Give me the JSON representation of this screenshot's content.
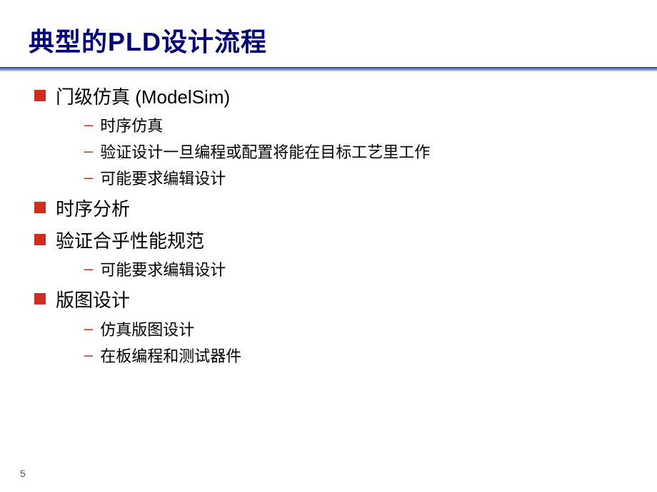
{
  "title": "典型的PLD设计流程",
  "bullets": [
    {
      "text": "门级仿真 (ModelSim)",
      "sub": [
        "时序仿真",
        "验证设计一旦编程或配置将能在目标工艺里工作",
        "可能要求编辑设计"
      ]
    },
    {
      "text": "时序分析",
      "sub": []
    },
    {
      "text": "验证合乎性能规范",
      "sub": [
        "可能要求编辑设计"
      ]
    },
    {
      "text": "版图设计",
      "sub": [
        "仿真版图设计",
        "在板编程和测试器件"
      ]
    }
  ],
  "page_number": "5"
}
